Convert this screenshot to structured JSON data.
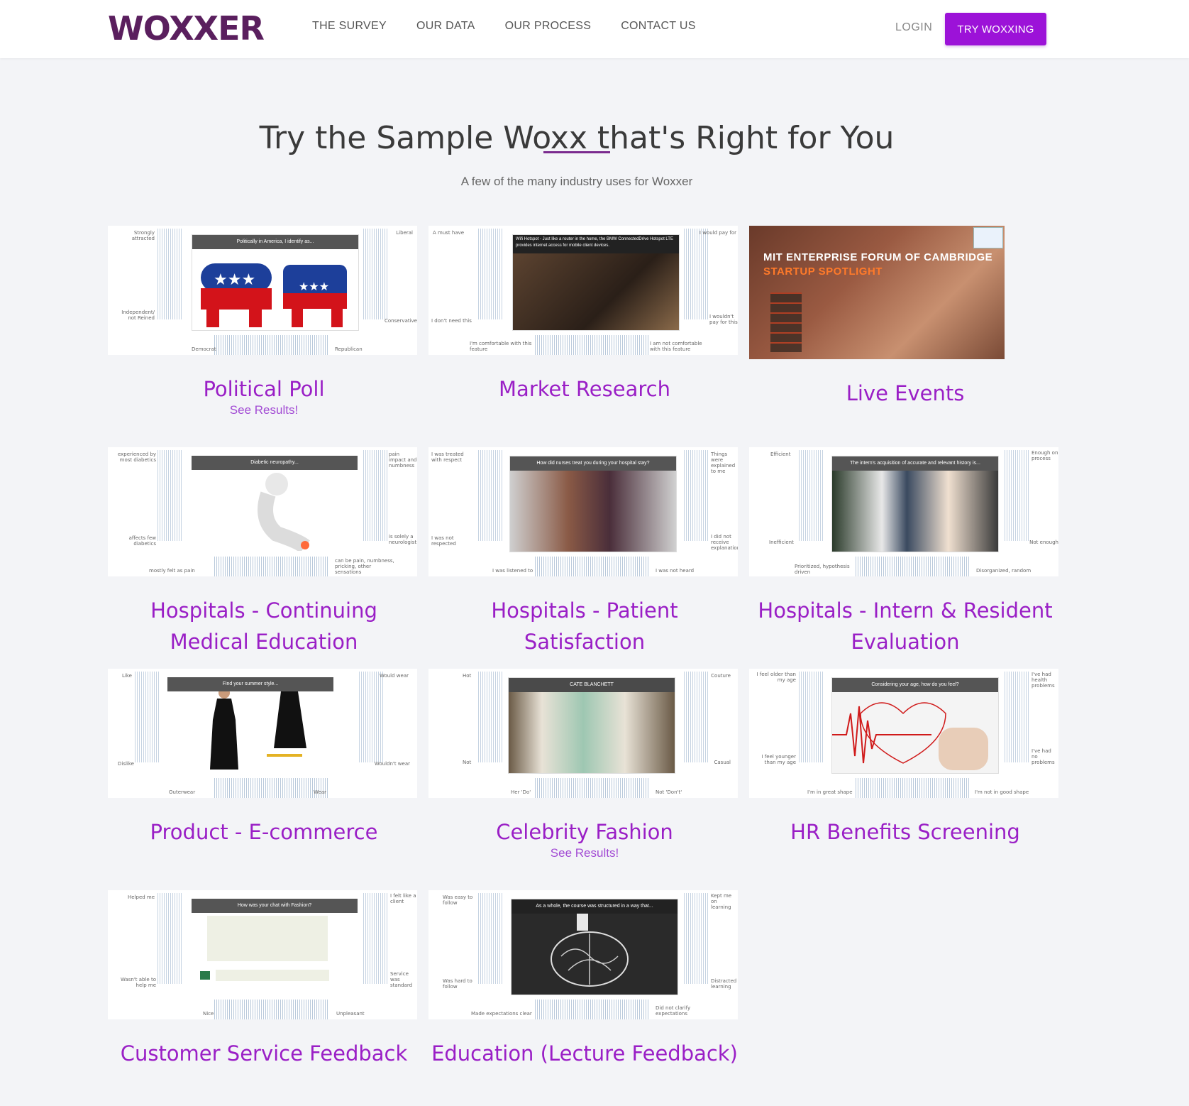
{
  "brand": {
    "logo": "WOXXER"
  },
  "nav": {
    "items": [
      "THE SURVEY",
      "OUR DATA",
      "OUR PROCESS",
      "CONTACT US"
    ],
    "login": "LOGIN",
    "cta": "TRY WOXXING"
  },
  "hero": {
    "title": "Try the Sample Woxx that's Right for You",
    "subtitle": "A few of the many industry uses for Woxxer"
  },
  "colors": {
    "accent": "#9c12d8",
    "link": "#9a1fc6",
    "logo": "#5a1f5e"
  },
  "cards": [
    {
      "title": "Political Poll",
      "link": "See Results!",
      "caption": "Politically in America, I identify as...",
      "labels": [
        "Strongly attracted",
        "Liberal",
        "Independent/ not Reined",
        "Conservative",
        "Democrat",
        "Republican"
      ]
    },
    {
      "title": "Market Research",
      "caption": "Wifi Hotspot - Just like a router in the home, the BMW ConnectedDrive Hotspot LTE provides internet access for mobile client devices.",
      "labels": [
        "A must have",
        "I would pay for",
        "I don't need this",
        "I wouldn't pay for this",
        "I'm comfortable with this feature",
        "I am not comfortable with this feature"
      ]
    },
    {
      "title": "Live Events",
      "caption": "MIT ENTERPRISE FORUM OF CAMBRIDGE",
      "caption2": "STARTUP SPOTLIGHT"
    },
    {
      "title": "Hospitals - Continuing Medical Education",
      "caption": "Diabetic neuropathy...",
      "labels": [
        "experienced by most diabetics",
        "pain impact and numbness",
        "affects few diabetics",
        "is solely a neurologist",
        "mostly felt as pain",
        "can be pain, numbness, pricking, other sensations"
      ]
    },
    {
      "title": "Hospitals - Patient Satisfaction",
      "caption": "How did nurses treat you during your hospital stay?",
      "labels": [
        "I was treated with respect",
        "Things were explained to me",
        "I was not respected",
        "I did not receive explanations",
        "I was listened to",
        "I was not heard"
      ]
    },
    {
      "title": "Hospitals - Intern & Resident Evaluation",
      "caption": "The intern's acquisition of accurate and relevant history is...",
      "labels": [
        "Efficient",
        "Enough on process",
        "Inefficient",
        "Not enough",
        "Prioritized, hypothesis driven",
        "Disorganized, random"
      ]
    },
    {
      "title": "Product - E-commerce",
      "caption": "Find your summer style...",
      "labels": [
        "Like",
        "Would wear",
        "Dislike",
        "Wouldn't wear",
        "Outerwear",
        "Wear"
      ]
    },
    {
      "title": "Celebrity Fashion",
      "link": "See Results!",
      "caption": "CATE BLANCHETT",
      "labels": [
        "Hot",
        "Couture",
        "Not",
        "Casual",
        "Her 'Do'",
        "Not 'Don't'"
      ]
    },
    {
      "title": "HR Benefits Screening",
      "caption": "Considering your age, how do you feel?",
      "labels": [
        "I feel older than my age",
        "I've had health problems",
        "I feel younger than my age",
        "I've had no problems",
        "I'm in great shape",
        "I'm not in good shape"
      ]
    },
    {
      "title": "Customer Service Feedback",
      "caption": "How was your chat with Fashion?",
      "labels": [
        "Helped me",
        "I felt like a client",
        "Wasn't able to help me",
        "Service was standard",
        "Nice",
        "Unpleasant"
      ]
    },
    {
      "title": "Education (Lecture Feedback)",
      "caption": "As a whole, the course was structured in a way that...",
      "labels": [
        "Was easy to follow",
        "Kept me on learning",
        "Was hard to follow",
        "Distracted learning",
        "Made expectations clear",
        "Did not clarify expectations"
      ]
    }
  ]
}
